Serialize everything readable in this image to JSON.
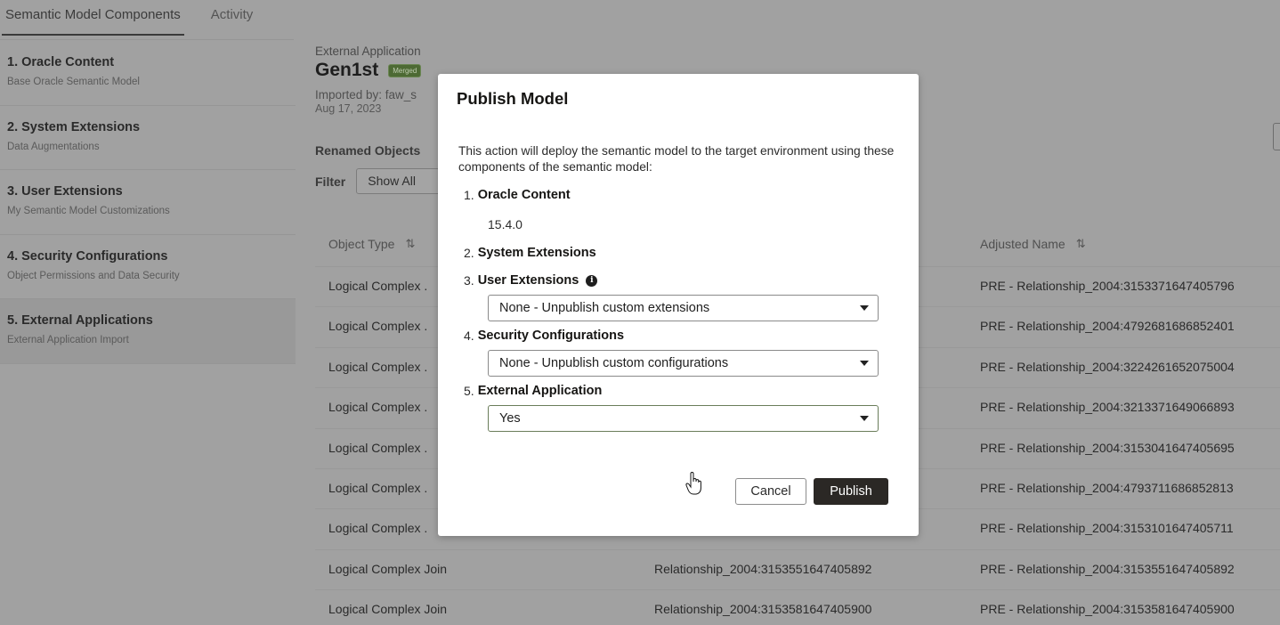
{
  "tabs": [
    {
      "label": "Semantic Model Components",
      "active": true
    },
    {
      "label": "Activity",
      "active": false
    }
  ],
  "sidebar": {
    "items": [
      {
        "title": "1. Oracle Content",
        "subtitle": "Base Oracle Semantic Model",
        "selected": false
      },
      {
        "title": "2. System Extensions",
        "subtitle": "Data Augmentations",
        "selected": false
      },
      {
        "title": "3. User Extensions",
        "subtitle": "My Semantic Model Customizations",
        "selected": false
      },
      {
        "title": "4. Security Configurations",
        "subtitle": "Object Permissions and Data Security",
        "selected": false
      },
      {
        "title": "5. External Applications",
        "subtitle": "External Application Import",
        "selected": true
      }
    ]
  },
  "main": {
    "section_label": "External Application",
    "app_title": "Gen1st",
    "badge": "Merged",
    "imported_by": "Imported by: faw_s",
    "imported_date": "Aug 17, 2023",
    "renamed_title": "Renamed Objects",
    "filter_label": "Filter",
    "filter_value": "Show All"
  },
  "table": {
    "headers": {
      "object_type": "Object Type",
      "adjusted_name": "Adjusted Name",
      "sort_icon": "⇅"
    },
    "rows": [
      {
        "type": "Logical Complex .",
        "original": "",
        "adjusted": "PRE - Relationship_2004:3153371647405796"
      },
      {
        "type": "Logical Complex .",
        "original": "",
        "adjusted": "PRE - Relationship_2004:4792681686852401"
      },
      {
        "type": "Logical Complex .",
        "original": "",
        "adjusted": "PRE - Relationship_2004:3224261652075004"
      },
      {
        "type": "Logical Complex .",
        "original": "",
        "adjusted": "PRE - Relationship_2004:3213371649066893"
      },
      {
        "type": "Logical Complex .",
        "original": "",
        "adjusted": "PRE - Relationship_2004:3153041647405695"
      },
      {
        "type": "Logical Complex .",
        "original": "",
        "adjusted": "PRE - Relationship_2004:4793711686852813"
      },
      {
        "type": "Logical Complex .",
        "original": "",
        "adjusted": "PRE - Relationship_2004:3153101647405711"
      },
      {
        "type": "Logical Complex Join",
        "original": "Relationship_2004:3153551647405892",
        "adjusted": "PRE - Relationship_2004:3153551647405892"
      },
      {
        "type": "Logical Complex Join",
        "original": "Relationship_2004:3153581647405900",
        "adjusted": "PRE - Relationship_2004:3153581647405900"
      }
    ]
  },
  "modal": {
    "title": "Publish Model",
    "description": "This action will deploy the semantic model to the target environment using these components of the semantic model:",
    "sections": [
      {
        "num": "1.",
        "title": "Oracle Content",
        "version": "15.4.0"
      },
      {
        "num": "2.",
        "title": "System Extensions"
      },
      {
        "num": "3.",
        "title": "User Extensions",
        "info_icon": "i",
        "select_value": "None - Unpublish custom extensions"
      },
      {
        "num": "4.",
        "title": "Security Configurations",
        "select_value": "None - Unpublish custom configurations"
      },
      {
        "num": "5.",
        "title": "External Application",
        "select_value": "Yes"
      }
    ],
    "cancel_label": "Cancel",
    "publish_label": "Publish"
  },
  "colors": {
    "overlay": "#a1a1a1",
    "badge": "#4d6a34",
    "primary_button": "#2b2825"
  }
}
